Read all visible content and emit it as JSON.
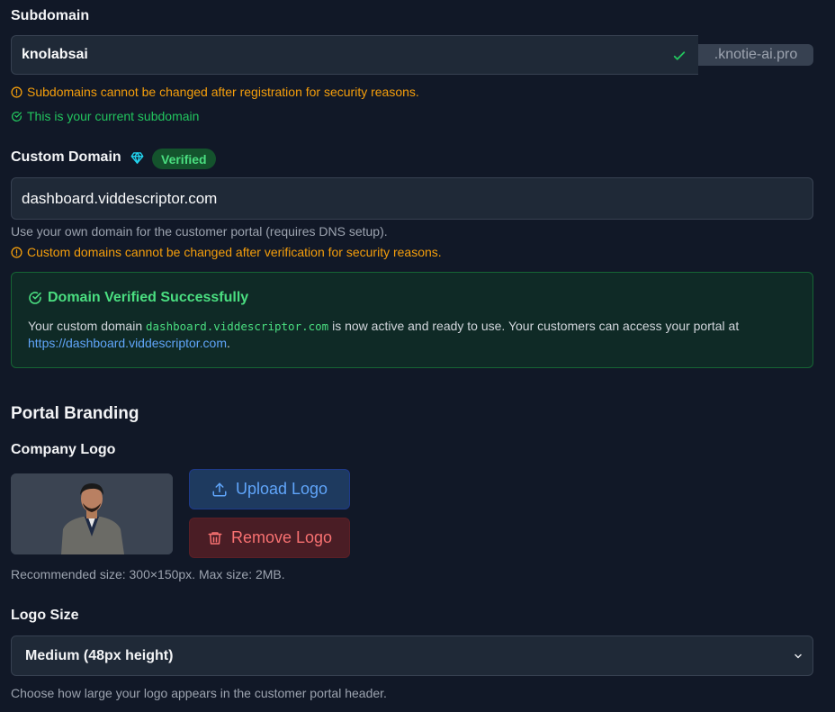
{
  "subdomain": {
    "label": "Subdomain",
    "value": "knolabsai",
    "suffix": ".knotie-ai.pro",
    "warning": "Subdomains cannot be changed after registration for security reasons.",
    "status": "This is your current subdomain"
  },
  "custom_domain": {
    "label": "Custom Domain",
    "badge": "Verified",
    "value": "dashboard.viddescriptor.com",
    "help": "Use your own domain for the customer portal (requires DNS setup).",
    "warning": "Custom domains cannot be changed after verification for security reasons."
  },
  "verified_panel": {
    "title": "Domain Verified Successfully",
    "text_before": "Your custom domain ",
    "domain_code": "dashboard.viddescriptor.com",
    "text_after": " is now active and ready to use. Your customers can access your portal at ",
    "link": "https://dashboard.viddescriptor.com",
    "period": "."
  },
  "branding": {
    "section_title": "Portal Branding",
    "logo_label": "Company Logo",
    "upload_label": "Upload Logo",
    "remove_label": "Remove Logo",
    "logo_hint": "Recommended size: 300×150px. Max size: 2MB.",
    "logo_size_label": "Logo Size",
    "logo_size_value": "Medium (48px height)",
    "logo_size_help": "Choose how large your logo appears in the customer portal header."
  },
  "colors": {
    "background": "#111827",
    "success": "#22c55e",
    "warning": "#f59e0b",
    "link": "#60a5fa",
    "danger": "#f87171"
  }
}
